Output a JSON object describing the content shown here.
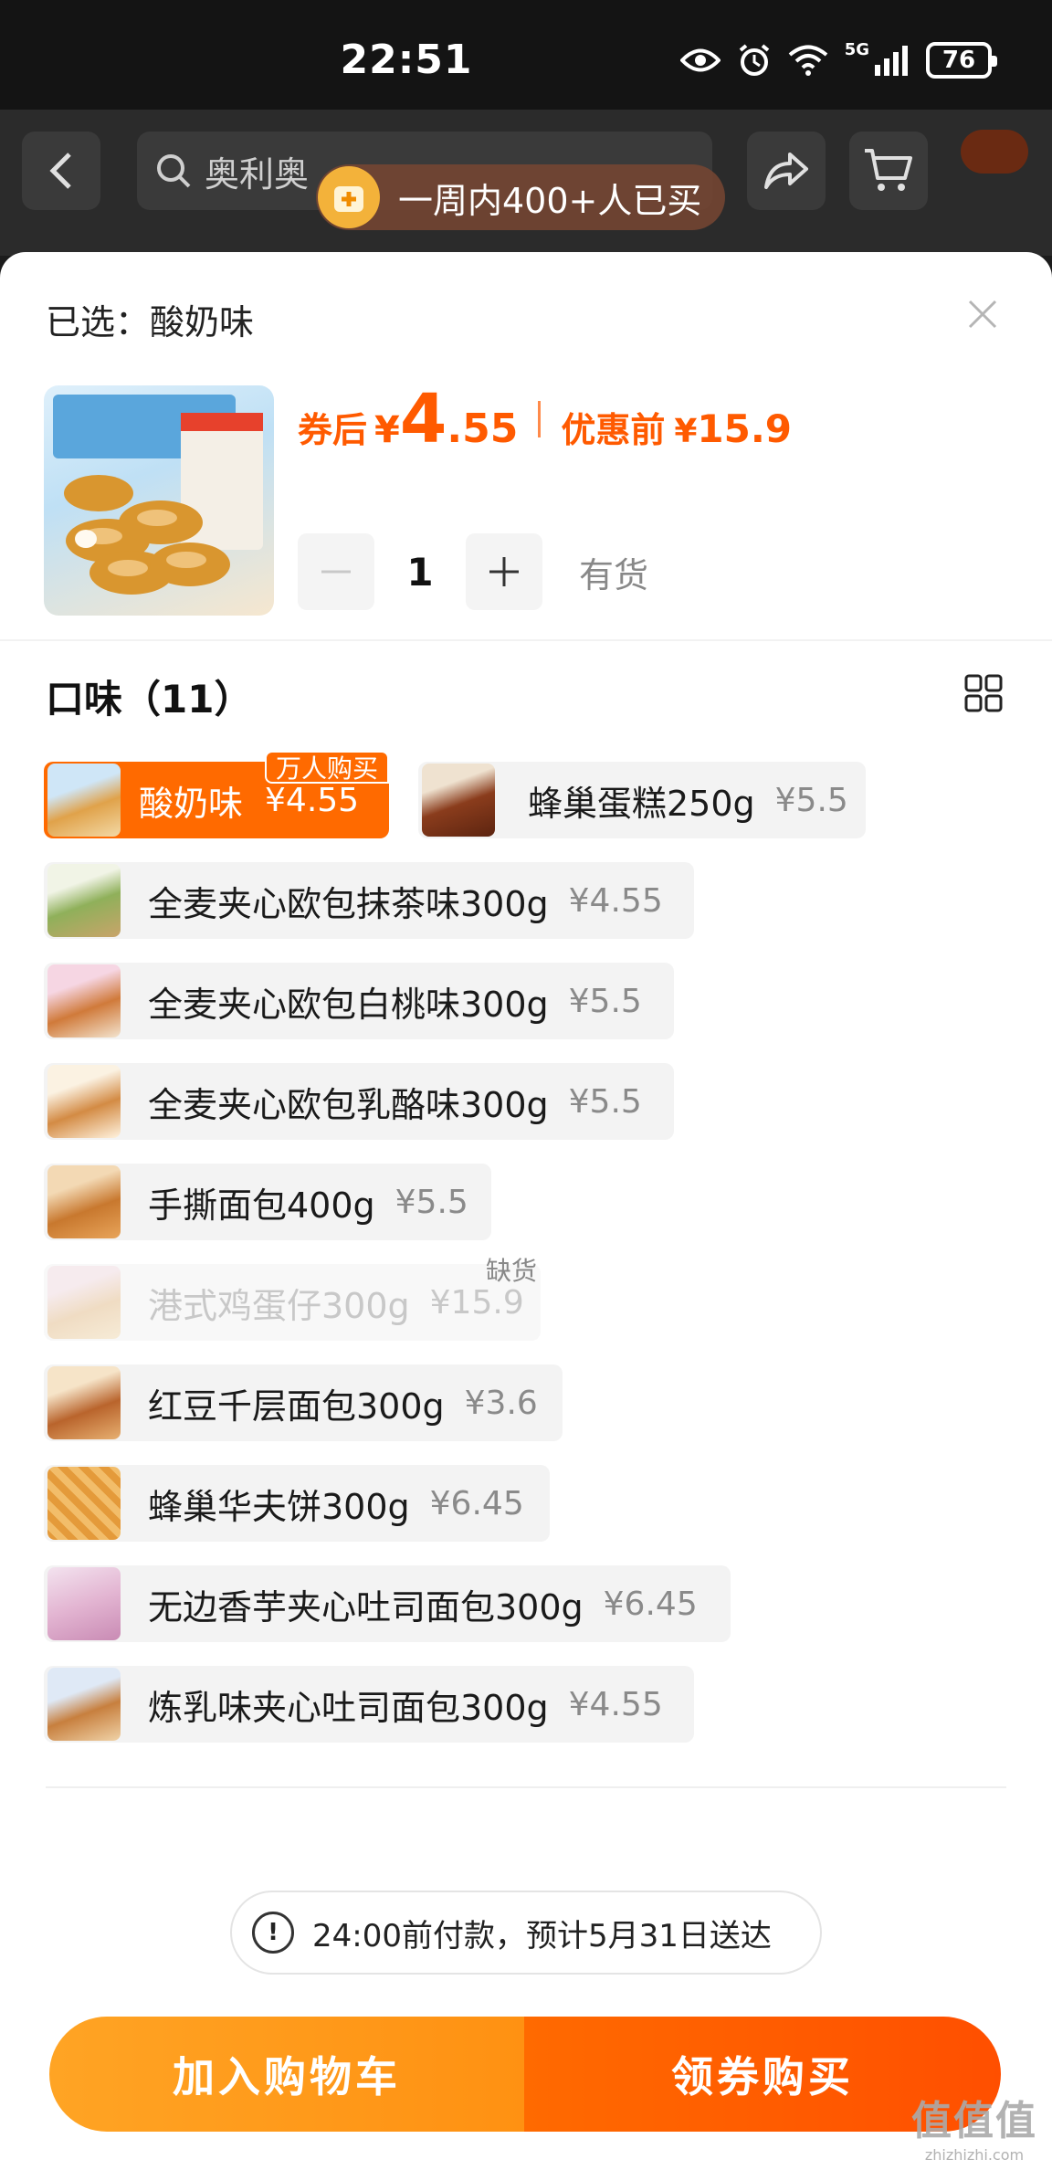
{
  "status_bar": {
    "time": "22:51",
    "network": "5G",
    "battery": "76"
  },
  "header": {
    "search_text": "奥利奥",
    "toast": "一周内400+人已买"
  },
  "sheet": {
    "selected_label": "已选：酸奶味",
    "price_after_label": "券后",
    "currency": "¥",
    "price_after_int": "4",
    "price_after_dec": ".55",
    "price_before_label": "优惠前",
    "price_before": "15.9",
    "quantity": "1",
    "stock_status": "有货",
    "section_title": "口味（11）"
  },
  "options": [
    {
      "name": "酸奶味",
      "price": "¥4.55",
      "selected": true,
      "badge": "万人购买"
    },
    {
      "name": "蜂巢蛋糕250g",
      "price": "¥5.5"
    },
    {
      "name": "全麦夹心欧包抹茶味300g",
      "price": "¥4.55"
    },
    {
      "name": "全麦夹心欧包白桃味300g",
      "price": "¥5.5"
    },
    {
      "name": "全麦夹心欧包乳酪味300g",
      "price": "¥5.5"
    },
    {
      "name": "手撕面包400g",
      "price": "¥5.5"
    },
    {
      "name": "港式鸡蛋仔300g",
      "price": "¥15.9",
      "disabled": true,
      "badge": "缺货"
    },
    {
      "name": "红豆千层面包300g",
      "price": "¥3.6"
    },
    {
      "name": "蜂巢华夫饼300g",
      "price": "¥6.45"
    },
    {
      "name": "无边香芋夹心吐司面包300g",
      "price": "¥6.45"
    },
    {
      "name": "炼乳味夹心吐司面包300g",
      "price": "¥4.55"
    }
  ],
  "delivery_note": "24:00前付款，预计5月31日送达",
  "actions": {
    "add_to_cart": "加入购物车",
    "buy_now": "领券购买"
  },
  "watermark": {
    "main": "值值值",
    "sub": "zhizhizhi.com"
  },
  "colors": {
    "accent": "#ff6a00",
    "cart_button": "#ff9a1a",
    "buy_button": "#ff5500"
  }
}
